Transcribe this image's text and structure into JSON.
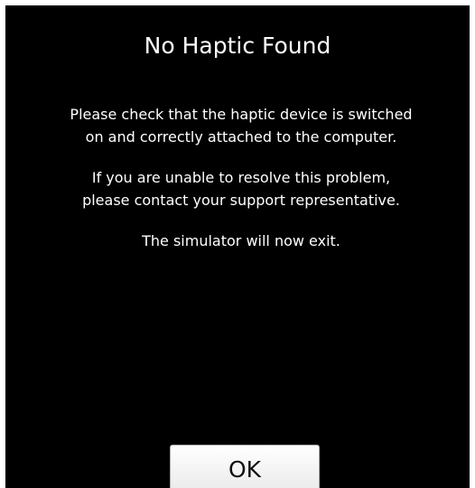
{
  "dialog": {
    "title": "No Haptic Found",
    "paragraph_1_line_1": "Please check that the haptic device is switched",
    "paragraph_1_line_2": "on and correctly attached to the computer.",
    "paragraph_2_line_1": "If you are unable to resolve this problem,",
    "paragraph_2_line_2": "please contact your support representative.",
    "paragraph_3": "The simulator will now exit.",
    "ok_label": "OK"
  },
  "colors": {
    "background": "#000000",
    "text": "#ffffff",
    "button_face": "#f0f0f0"
  }
}
